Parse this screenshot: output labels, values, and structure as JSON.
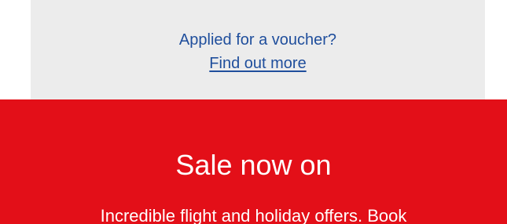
{
  "voucher": {
    "question": "Applied for a voucher?",
    "link_label": "Find out more"
  },
  "sale_banner": {
    "heading": "Sale now on",
    "body": "Incredible flight and holiday offers. Book"
  },
  "colors": {
    "voucher_background": "#ececec",
    "link_text": "#1f4e9c",
    "sale_background": "#e30f18",
    "sale_text": "#ffffff"
  }
}
